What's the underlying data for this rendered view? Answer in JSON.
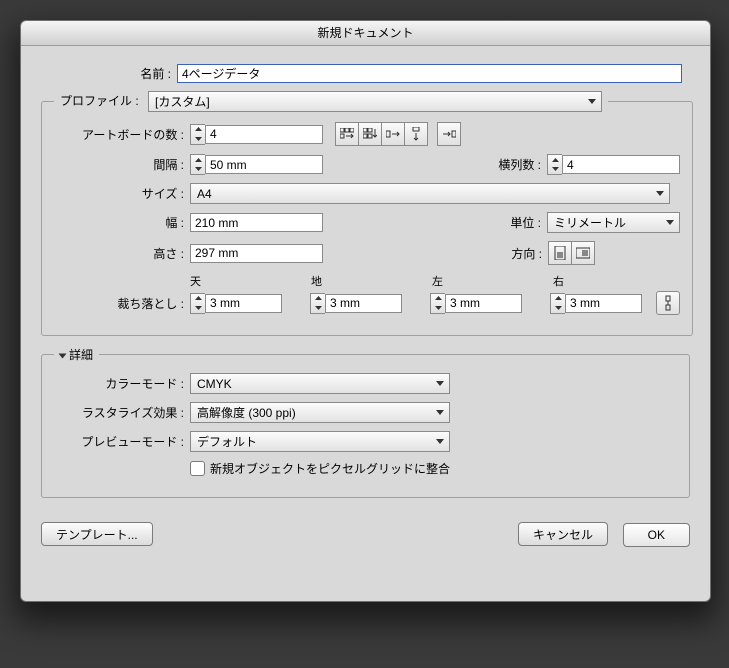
{
  "title": "新規ドキュメント",
  "name": {
    "label": "名前 :",
    "value": "4ページデータ"
  },
  "profile": {
    "label": "プロファイル :",
    "value": "[カスタム]"
  },
  "artboards": {
    "label": "アートボードの数 :",
    "value": "4"
  },
  "spacing": {
    "label": "間隔 :",
    "value": "50 mm"
  },
  "cols": {
    "label": "横列数 :",
    "value": "4"
  },
  "size": {
    "label": "サイズ :",
    "value": "A4"
  },
  "width": {
    "label": "幅 :",
    "value": "210 mm"
  },
  "height": {
    "label": "高さ :",
    "value": "297 mm"
  },
  "units": {
    "label": "単位 :",
    "value": "ミリメートル"
  },
  "orient": {
    "label": "方向 :"
  },
  "bleed": {
    "label": "裁ち落とし :",
    "top": "天",
    "bottom": "地",
    "left": "左",
    "right": "右",
    "value": "3 mm"
  },
  "details": {
    "label": "詳細"
  },
  "color": {
    "label": "カラーモード :",
    "value": "CMYK"
  },
  "raster": {
    "label": "ラスタライズ効果 :",
    "value": "高解像度 (300 ppi)"
  },
  "preview": {
    "label": "プレビューモード :",
    "value": "デフォルト"
  },
  "pixelgrid": {
    "label": "新規オブジェクトをピクセルグリッドに整合"
  },
  "buttons": {
    "template": "テンプレート...",
    "cancel": "キャンセル",
    "ok": "OK"
  }
}
